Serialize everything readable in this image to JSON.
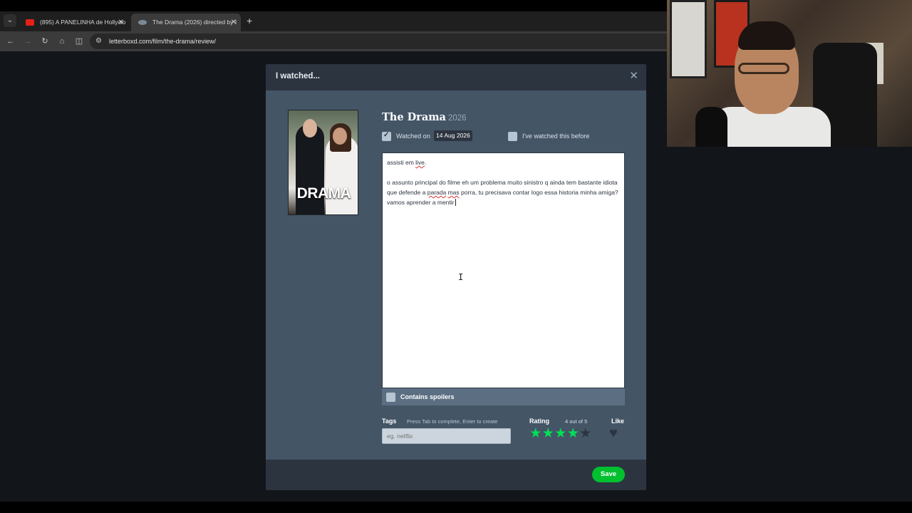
{
  "browser": {
    "tab_list_icon": "chevron-down-icon",
    "tabs": [
      {
        "title": "(895) A PANELINHA de Hollywo",
        "favicon": "youtube-icon",
        "active": false
      },
      {
        "title": "The Drama (2026) directed by I",
        "favicon": "letterboxd-icon",
        "active": true
      }
    ],
    "close_glyph": "✕",
    "new_tab_glyph": "+",
    "url": "letterboxd.com/film/the-drama/review/"
  },
  "modal": {
    "title": "I watched...",
    "close_glyph": "✕",
    "poster_word": "DRAMA",
    "film": {
      "title": "The Drama",
      "year": "2026"
    },
    "watched_on": {
      "label": "Watched on",
      "checked": true,
      "date": "14 Aug 2026"
    },
    "rewatch": {
      "label": "I've watched this before",
      "checked": false
    },
    "review": {
      "line1_a": "assisti em ",
      "line1_b": "live",
      "line1_c": ".",
      "para2_a": "o assunto principal do filme eh um problema muito sinistro q ainda tem bastante idiota que defende a ",
      "para2_b": "parada",
      "para2_c": " ",
      "para2_d": "mas",
      "para2_e": " porra, tu precisava contar logo essa historia minha amiga? vamos aprender a mentir"
    },
    "spoilers": {
      "label": "Contains spoilers",
      "checked": false
    },
    "tags": {
      "label": "Tags",
      "hint": "Press Tab to complete, Enter to create",
      "placeholder": "eg. netflix"
    },
    "rating": {
      "label": "Rating",
      "summary": "4 out of 5",
      "value": 4,
      "max": 5,
      "star_glyph": "★"
    },
    "like": {
      "label": "Like",
      "liked": false,
      "glyph": "♥"
    },
    "save_label": "Save"
  },
  "colors": {
    "modal_bg": "#445566",
    "header_bg": "#2c3440",
    "star_on": "#00e054",
    "save_green": "#00c030"
  }
}
